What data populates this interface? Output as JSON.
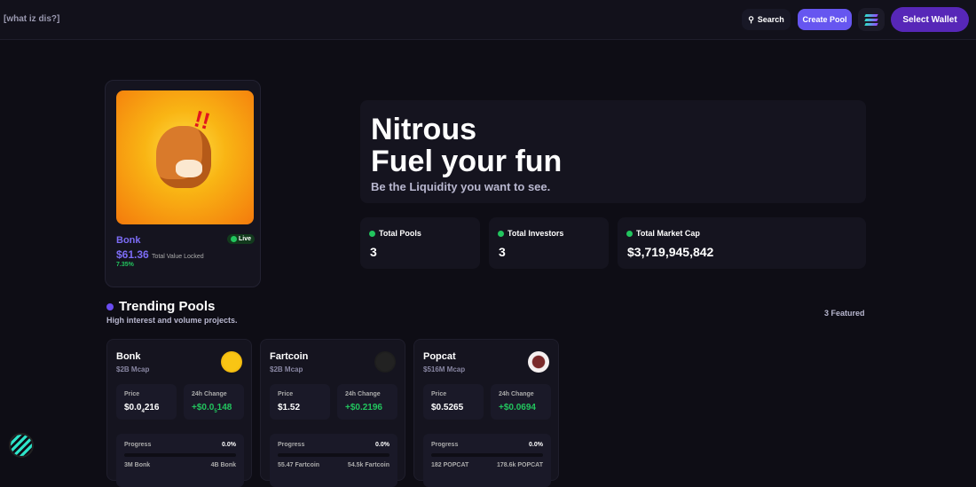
{
  "header": {
    "what_link": "[what iz dis?]",
    "search_label": "Search",
    "create_pool_label": "Create Pool",
    "network_icon": "solana-icon",
    "wallet_label": "Select Wallet"
  },
  "featured": {
    "name": "Bonk",
    "live_label": "Live",
    "tvl": "$61.36",
    "tvl_label": "Total Value Locked",
    "percent": "7.35%"
  },
  "hero": {
    "line1": "Nitrous",
    "line2": "Fuel your fun",
    "subtitle": "Be the Liquidity you want to see."
  },
  "stats": [
    {
      "label": "Total Pools",
      "value": "3"
    },
    {
      "label": "Total Investors",
      "value": "3"
    },
    {
      "label": "Total Market Cap",
      "value": "$3,719,945,842"
    }
  ],
  "trending": {
    "title": "Trending Pools",
    "subtitle": "High interest and volume projects.",
    "featured_count": "3 Featured"
  },
  "labels": {
    "price": "Price",
    "change": "24h Change",
    "progress": "Progress"
  },
  "pools": [
    {
      "name": "Bonk",
      "mcap": "$2B Mcap",
      "price_pre": "$0.0",
      "price_sub": "4",
      "price_post": "216",
      "change_pre": "+$0.0",
      "change_sub": "5",
      "change_post": "148",
      "progress_text": "0.0%",
      "progress": 0,
      "raised": "3M Bonk",
      "goal": "4B Bonk"
    },
    {
      "name": "Fartcoin",
      "mcap": "$2B Mcap",
      "price_pre": "$1.52",
      "price_sub": "",
      "price_post": "",
      "change_pre": "+$0.2196",
      "change_sub": "",
      "change_post": "",
      "progress_text": "0.0%",
      "progress": 0,
      "raised": "55.47 Fartcoin",
      "goal": "54.5k Fartcoin"
    },
    {
      "name": "Popcat",
      "mcap": "$516M Mcap",
      "price_pre": "$0.5265",
      "price_sub": "",
      "price_post": "",
      "change_pre": "+$0.0694",
      "change_sub": "",
      "change_post": "",
      "progress_text": "0.0%",
      "progress": 0,
      "raised": "182 POPCAT",
      "goal": "178.6k POPCAT"
    }
  ]
}
